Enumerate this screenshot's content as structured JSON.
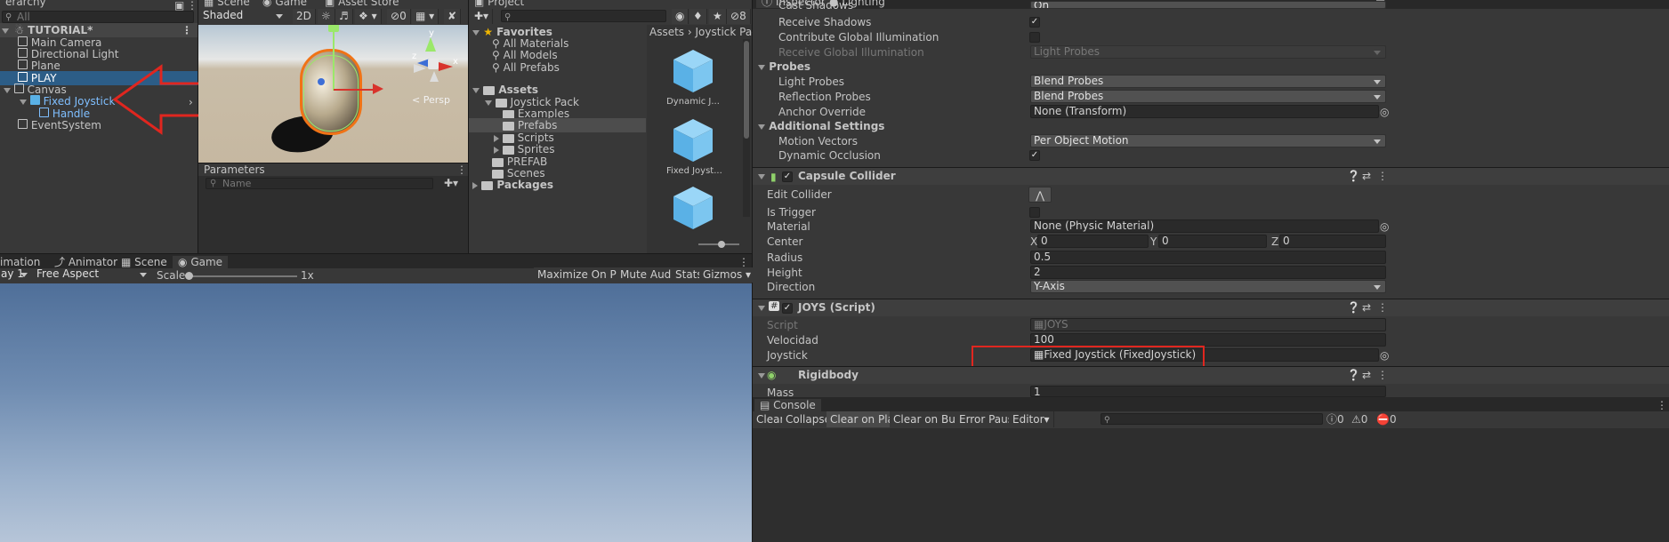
{
  "hierarchy": {
    "tab_label": "erarchy",
    "search_placeholder": "All",
    "scene_name": "TUTORIAL*",
    "items": [
      {
        "label": "Main Camera"
      },
      {
        "label": "Directional Light"
      },
      {
        "label": "Plane"
      },
      {
        "label": "PLAY"
      },
      {
        "label": "Canvas"
      },
      {
        "label": "Fixed Joystick"
      },
      {
        "label": "Handle"
      },
      {
        "label": "EventSystem"
      }
    ]
  },
  "scene_view": {
    "tabs": [
      "Scene",
      "Game",
      "Asset Store"
    ],
    "shading_mode": "Shaded",
    "toggle_2d": "2D",
    "hidden_count": "0",
    "persp_label": "< Persp",
    "gizmo_axes": {
      "y": "y",
      "z": "z",
      "x": "x"
    }
  },
  "parameters": {
    "tab_label": "Parameters",
    "search_placeholder": "Name"
  },
  "project": {
    "tab_label": "Project",
    "favorites_label": "Favorites",
    "favorites": [
      "All Materials",
      "All Models",
      "All Prefabs"
    ],
    "assets_label": "Assets",
    "tree": [
      {
        "label": "Joystick Pack"
      },
      {
        "label": "Examples"
      },
      {
        "label": "Prefabs"
      },
      {
        "label": "Scripts"
      },
      {
        "label": "Sprites"
      },
      {
        "label": "PREFAB"
      },
      {
        "label": "Scenes"
      },
      {
        "label": "Packages"
      }
    ],
    "breadcrumb": [
      "Assets",
      "Joystick Pack"
    ],
    "assets": [
      "Dynamic J...",
      "Fixed Joyst...",
      ""
    ],
    "visible_count": "8"
  },
  "game_view": {
    "tabs": [
      "imation",
      "Animator",
      "Scene",
      "Game"
    ],
    "display_label": "ay 1",
    "aspect": "Free Aspect",
    "scale_label": "Scale",
    "scale_value": "1x",
    "toolbar_buttons": [
      "Maximize On Play",
      "Mute Audio",
      "Stats",
      "Gizmos"
    ]
  },
  "inspector": {
    "tabs": [
      "Inspector",
      "Lighting"
    ],
    "partial_top": "Cast Shadows",
    "partial_top_value": "On",
    "mesh_renderer": [
      {
        "label": "Receive Shadows",
        "checked": true
      },
      {
        "label": "Contribute Global Illumination",
        "checked": false
      }
    ],
    "receive_gi": {
      "label": "Receive Global Illumination",
      "value": "Light Probes"
    },
    "probes_label": "Probes",
    "light_probes": {
      "label": "Light Probes",
      "value": "Blend Probes"
    },
    "reflection_probes": {
      "label": "Reflection Probes",
      "value": "Blend Probes"
    },
    "anchor_override": {
      "label": "Anchor Override",
      "value": "None (Transform)"
    },
    "additional_label": "Additional Settings",
    "motion_vectors": {
      "label": "Motion Vectors",
      "value": "Per Object Motion"
    },
    "dynamic_occlusion": {
      "label": "Dynamic Occlusion",
      "checked": true
    },
    "capsule_collider": {
      "title": "Capsule Collider",
      "edit_collider": "Edit Collider",
      "is_trigger": "Is Trigger",
      "material_label": "Material",
      "material_value": "None (Physic Material)",
      "center_label": "Center",
      "center": {
        "x": "0",
        "y": "0",
        "z": "0"
      },
      "radius_label": "Radius",
      "radius": "0.5",
      "height_label": "Height",
      "height": "2",
      "direction_label": "Direction",
      "direction": "Y-Axis"
    },
    "joys_script": {
      "title": "JOYS (Script)",
      "script_label": "Script",
      "script_value": "JOYS",
      "velocidad_label": "Velocidad",
      "velocidad": "100",
      "joystick_label": "Joystick",
      "joystick_value": "Fixed Joystick (FixedJoystick)"
    },
    "rigidbody": {
      "title": "Rigidbody",
      "mass_label": "Mass",
      "mass": "1"
    }
  },
  "console": {
    "tab_label": "Console",
    "buttons": [
      "Clear",
      "Collapse",
      "Clear on Play",
      "Clear on Build",
      "Error Pause",
      "Editor"
    ],
    "counts": [
      "0",
      "0",
      "0"
    ]
  },
  "colors": {
    "selection": "#2c5d87",
    "accent_blue": "#7fbfff",
    "annotation_red": "#e0261f",
    "panel_bg": "#383838"
  }
}
